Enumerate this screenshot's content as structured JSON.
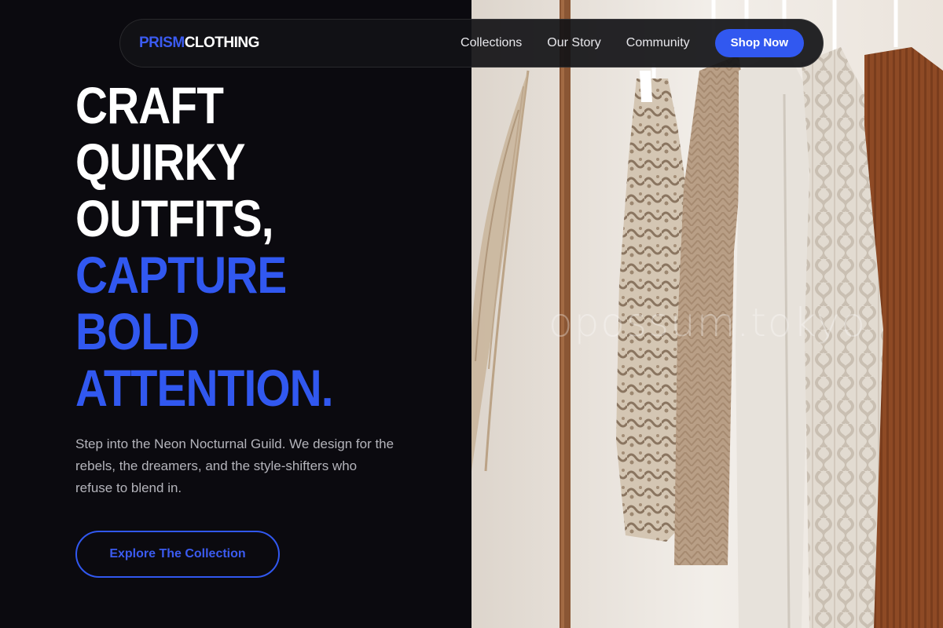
{
  "brand": {
    "accent_part": "PRISM",
    "rest_part": "CLOTHING"
  },
  "nav": {
    "links": [
      "Collections",
      "Our Story",
      "Community"
    ],
    "cta_label": "Shop Now"
  },
  "hero": {
    "headline_white": [
      "CRAFT",
      "QUIRKY",
      "OUTFITS,"
    ],
    "headline_blue": [
      "CAPTURE",
      "BOLD",
      "ATTENTION."
    ],
    "description": "Step into the Neon Nocturnal Guild. We design for the rebels, the dreamers, and the style-shifters who refuse to blend in.",
    "button_label": "Explore The Collection"
  },
  "photo": {
    "watermark": "opossum.tokyo"
  },
  "colors": {
    "background": "#0b0a0f",
    "accent": "#3158f0",
    "nav_bg": "#121216",
    "muted_text": "#b4b4bb"
  }
}
